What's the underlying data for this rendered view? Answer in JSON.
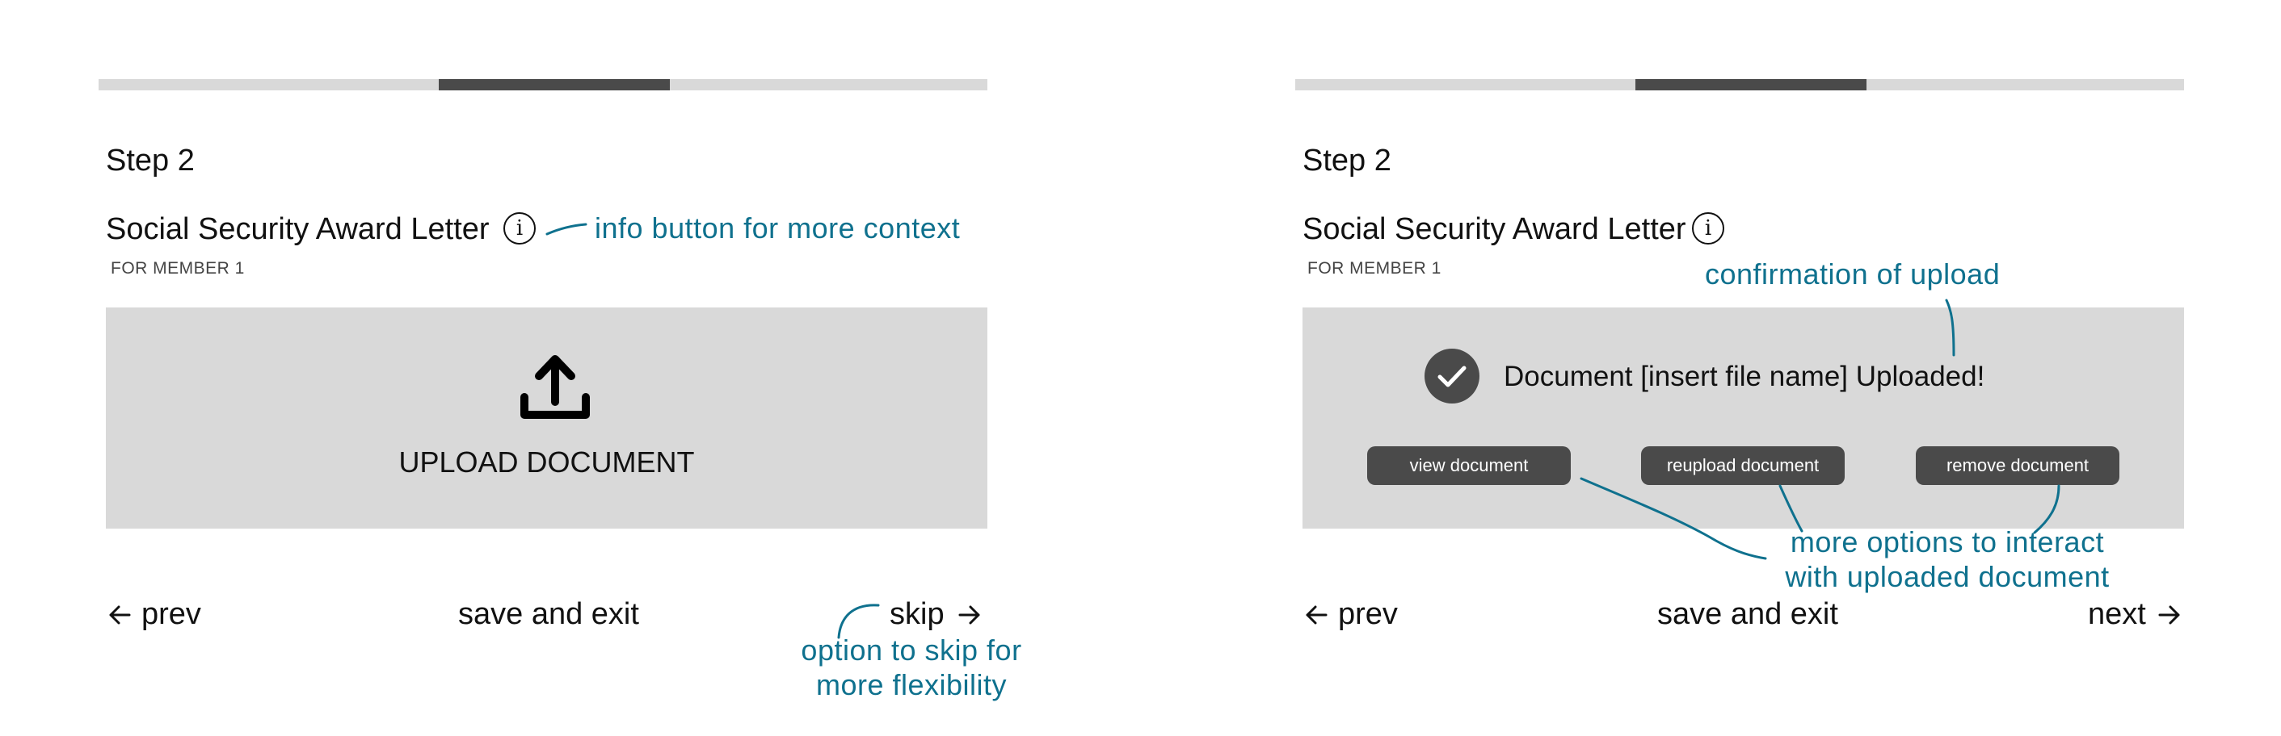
{
  "left_panel": {
    "progress": {
      "segment": 2,
      "segments": 4,
      "segment_start_fraction": 0.385,
      "segment_end_fraction": 0.645
    },
    "step_label": "Step 2",
    "document_title": "Social Security Award Letter",
    "member_label": "FOR MEMBER 1",
    "info_icon": "info-circle-icon",
    "upload_icon": "upload-icon",
    "upload_label": "UPLOAD DOCUMENT",
    "nav": {
      "prev_label": "prev",
      "save_label": "save and exit",
      "skip_label": "skip"
    }
  },
  "right_panel": {
    "progress": {
      "segment": 2,
      "segments": 4,
      "segment_start_fraction": 0.385,
      "segment_end_fraction": 0.645
    },
    "step_label": "Step 2",
    "document_title": "Social Security Award Letter",
    "member_label": "FOR MEMBER 1",
    "info_icon": "info-circle-icon",
    "check_icon": "check-circle-icon",
    "uploaded_message": "Document [insert file name] Uploaded!",
    "actions": {
      "view_label": "view document",
      "reupload_label": "reupload document",
      "remove_label": "remove document"
    },
    "nav": {
      "prev_label": "prev",
      "save_label": "save and exit",
      "next_label": "next"
    }
  },
  "annotations": {
    "info": "info button for more context",
    "skip_line1": "option to skip for",
    "skip_line2": "more flexibility",
    "confirmation": "confirmation of upload",
    "options_line1": "more options to interact",
    "options_line2": "with uploaded document"
  },
  "colors": {
    "annotation": "#0f718e",
    "progress_track": "#d9d9d9",
    "progress_fill": "#4a4a4a",
    "upload_area": "#d9d9d9",
    "button_dark": "#4a4a4a"
  }
}
